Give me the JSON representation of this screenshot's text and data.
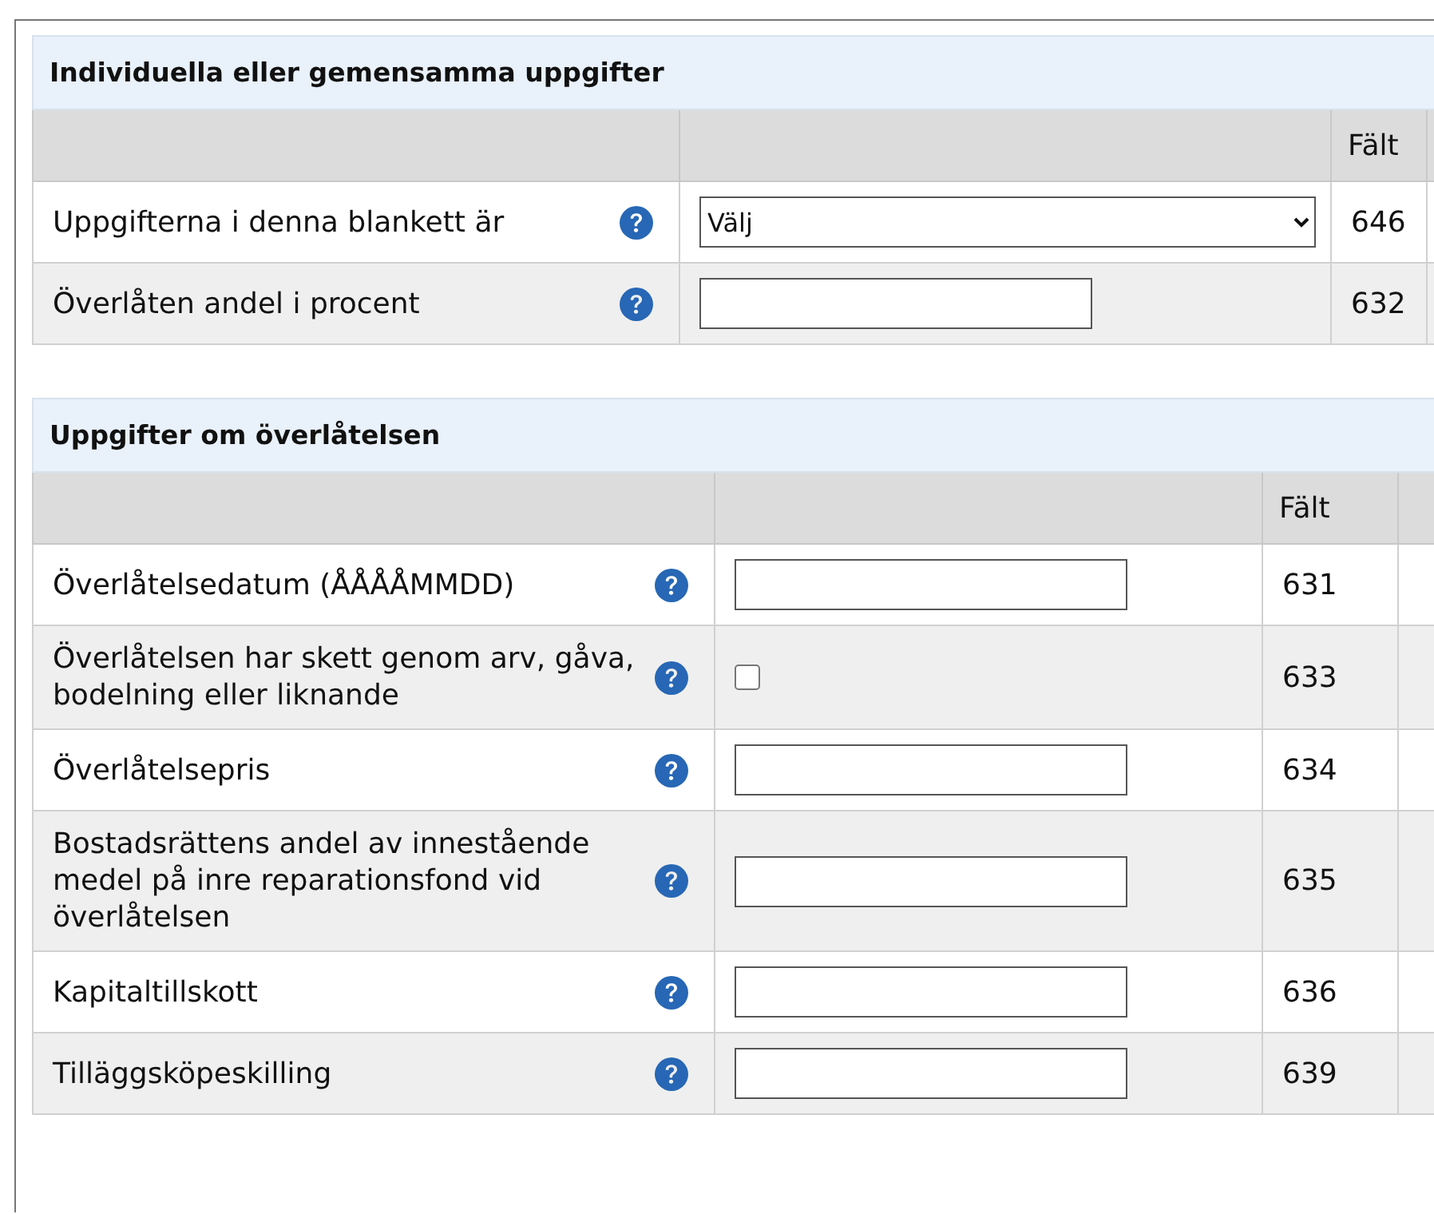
{
  "sections": [
    {
      "title": "Individuella eller gemensamma uppgifter",
      "field_heading": "Fält",
      "rows": [
        {
          "label": "Uppgifterna i denna blankett är",
          "control": {
            "kind": "select",
            "value": "Välj"
          },
          "field": "646"
        },
        {
          "label": "Överlåten andel i procent",
          "control": {
            "kind": "text"
          },
          "field": "632"
        }
      ]
    },
    {
      "title": "Uppgifter om överlåtelsen",
      "field_heading": "Fält",
      "rows": [
        {
          "label": "Överlåtelsedatum (ÅÅÅÅMMDD)",
          "control": {
            "kind": "text"
          },
          "field": "631"
        },
        {
          "label": "Överlåtelsen har skett genom arv, gåva, bodelning eller liknande",
          "control": {
            "kind": "checkbox",
            "checked": false
          },
          "field": "633"
        },
        {
          "label": "Överlåtelsepris",
          "control": {
            "kind": "text"
          },
          "field": "634"
        },
        {
          "label": "Bostadsrättens andel av innestående medel på inre reparationsfond vid överlåtelsen",
          "control": {
            "kind": "text"
          },
          "field": "635"
        },
        {
          "label": "Kapitaltillskott",
          "control": {
            "kind": "text"
          },
          "field": "636"
        },
        {
          "label": "Tilläggsköpeskilling",
          "control": {
            "kind": "text"
          },
          "field": "639"
        }
      ]
    }
  ]
}
